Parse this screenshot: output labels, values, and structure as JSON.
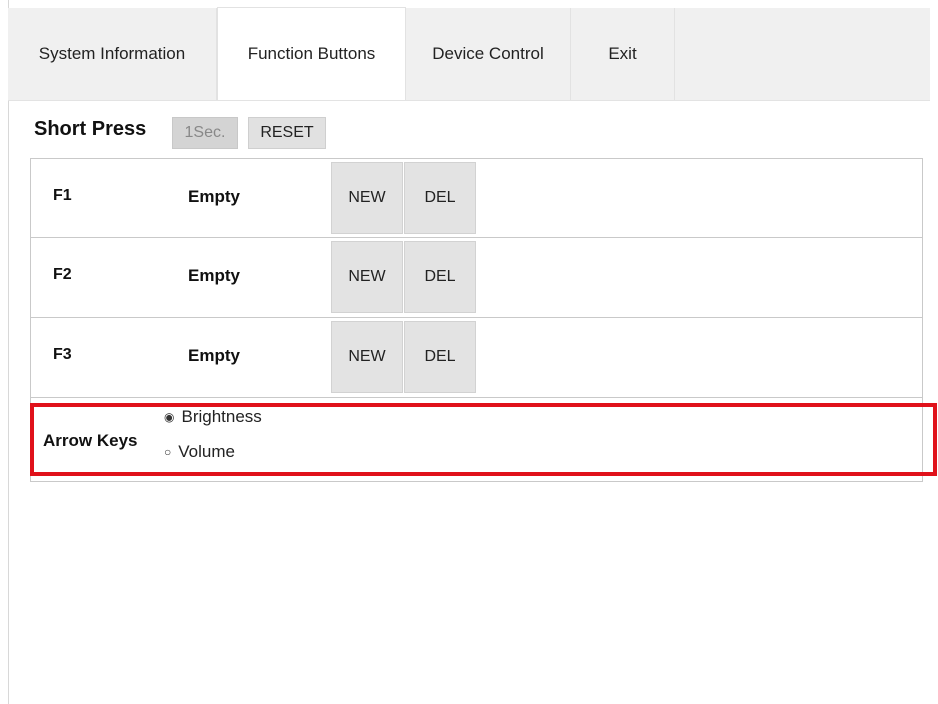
{
  "tabs": [
    {
      "label": "System Information"
    },
    {
      "label": "Function Buttons"
    },
    {
      "label": "Device Control"
    },
    {
      "label": "Exit"
    }
  ],
  "short_press": {
    "title": "Short Press",
    "duration_label": "1Sec.",
    "reset_label": "RESET"
  },
  "function_rows": [
    {
      "key": "F1",
      "value": "Empty",
      "new_label": "NEW",
      "del_label": "DEL"
    },
    {
      "key": "F2",
      "value": "Empty",
      "new_label": "NEW",
      "del_label": "DEL"
    },
    {
      "key": "F3",
      "value": "Empty",
      "new_label": "NEW",
      "del_label": "DEL"
    }
  ],
  "arrow_keys": {
    "label": "Arrow Keys",
    "options": [
      {
        "label": "Brightness",
        "selected": true
      },
      {
        "label": "Volume",
        "selected": false
      }
    ]
  },
  "colors": {
    "highlight": "#e0111a",
    "tabbar_bg": "#f0f0f0"
  }
}
